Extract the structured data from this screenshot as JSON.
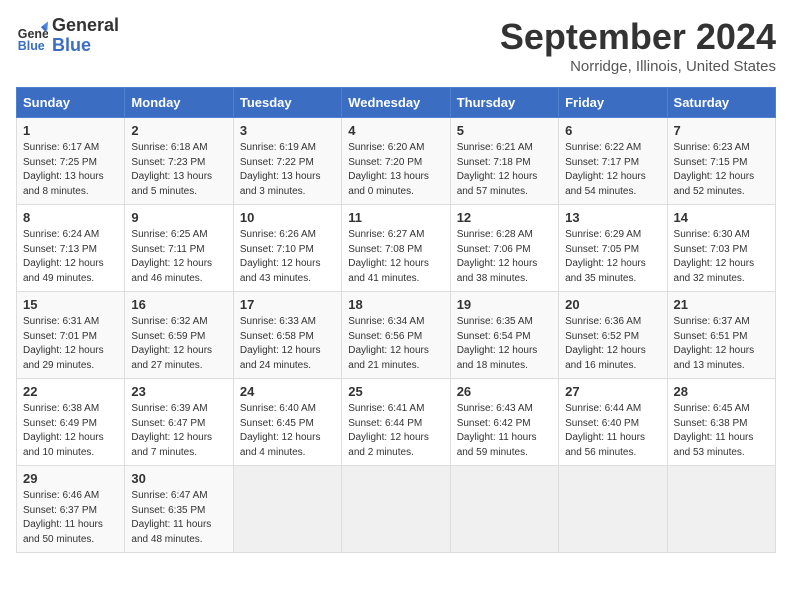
{
  "header": {
    "logo_line1": "General",
    "logo_line2": "Blue",
    "month_title": "September 2024",
    "location": "Norridge, Illinois, United States"
  },
  "days_of_week": [
    "Sunday",
    "Monday",
    "Tuesday",
    "Wednesday",
    "Thursday",
    "Friday",
    "Saturday"
  ],
  "weeks": [
    [
      {
        "day": 1,
        "sunrise": "6:17 AM",
        "sunset": "7:25 PM",
        "daylight": "13 hours and 8 minutes."
      },
      {
        "day": 2,
        "sunrise": "6:18 AM",
        "sunset": "7:23 PM",
        "daylight": "13 hours and 5 minutes."
      },
      {
        "day": 3,
        "sunrise": "6:19 AM",
        "sunset": "7:22 PM",
        "daylight": "13 hours and 3 minutes."
      },
      {
        "day": 4,
        "sunrise": "6:20 AM",
        "sunset": "7:20 PM",
        "daylight": "13 hours and 0 minutes."
      },
      {
        "day": 5,
        "sunrise": "6:21 AM",
        "sunset": "7:18 PM",
        "daylight": "12 hours and 57 minutes."
      },
      {
        "day": 6,
        "sunrise": "6:22 AM",
        "sunset": "7:17 PM",
        "daylight": "12 hours and 54 minutes."
      },
      {
        "day": 7,
        "sunrise": "6:23 AM",
        "sunset": "7:15 PM",
        "daylight": "12 hours and 52 minutes."
      }
    ],
    [
      {
        "day": 8,
        "sunrise": "6:24 AM",
        "sunset": "7:13 PM",
        "daylight": "12 hours and 49 minutes."
      },
      {
        "day": 9,
        "sunrise": "6:25 AM",
        "sunset": "7:11 PM",
        "daylight": "12 hours and 46 minutes."
      },
      {
        "day": 10,
        "sunrise": "6:26 AM",
        "sunset": "7:10 PM",
        "daylight": "12 hours and 43 minutes."
      },
      {
        "day": 11,
        "sunrise": "6:27 AM",
        "sunset": "7:08 PM",
        "daylight": "12 hours and 41 minutes."
      },
      {
        "day": 12,
        "sunrise": "6:28 AM",
        "sunset": "7:06 PM",
        "daylight": "12 hours and 38 minutes."
      },
      {
        "day": 13,
        "sunrise": "6:29 AM",
        "sunset": "7:05 PM",
        "daylight": "12 hours and 35 minutes."
      },
      {
        "day": 14,
        "sunrise": "6:30 AM",
        "sunset": "7:03 PM",
        "daylight": "12 hours and 32 minutes."
      }
    ],
    [
      {
        "day": 15,
        "sunrise": "6:31 AM",
        "sunset": "7:01 PM",
        "daylight": "12 hours and 29 minutes."
      },
      {
        "day": 16,
        "sunrise": "6:32 AM",
        "sunset": "6:59 PM",
        "daylight": "12 hours and 27 minutes."
      },
      {
        "day": 17,
        "sunrise": "6:33 AM",
        "sunset": "6:58 PM",
        "daylight": "12 hours and 24 minutes."
      },
      {
        "day": 18,
        "sunrise": "6:34 AM",
        "sunset": "6:56 PM",
        "daylight": "12 hours and 21 minutes."
      },
      {
        "day": 19,
        "sunrise": "6:35 AM",
        "sunset": "6:54 PM",
        "daylight": "12 hours and 18 minutes."
      },
      {
        "day": 20,
        "sunrise": "6:36 AM",
        "sunset": "6:52 PM",
        "daylight": "12 hours and 16 minutes."
      },
      {
        "day": 21,
        "sunrise": "6:37 AM",
        "sunset": "6:51 PM",
        "daylight": "12 hours and 13 minutes."
      }
    ],
    [
      {
        "day": 22,
        "sunrise": "6:38 AM",
        "sunset": "6:49 PM",
        "daylight": "12 hours and 10 minutes."
      },
      {
        "day": 23,
        "sunrise": "6:39 AM",
        "sunset": "6:47 PM",
        "daylight": "12 hours and 7 minutes."
      },
      {
        "day": 24,
        "sunrise": "6:40 AM",
        "sunset": "6:45 PM",
        "daylight": "12 hours and 4 minutes."
      },
      {
        "day": 25,
        "sunrise": "6:41 AM",
        "sunset": "6:44 PM",
        "daylight": "12 hours and 2 minutes."
      },
      {
        "day": 26,
        "sunrise": "6:43 AM",
        "sunset": "6:42 PM",
        "daylight": "11 hours and 59 minutes."
      },
      {
        "day": 27,
        "sunrise": "6:44 AM",
        "sunset": "6:40 PM",
        "daylight": "11 hours and 56 minutes."
      },
      {
        "day": 28,
        "sunrise": "6:45 AM",
        "sunset": "6:38 PM",
        "daylight": "11 hours and 53 minutes."
      }
    ],
    [
      {
        "day": 29,
        "sunrise": "6:46 AM",
        "sunset": "6:37 PM",
        "daylight": "11 hours and 50 minutes."
      },
      {
        "day": 30,
        "sunrise": "6:47 AM",
        "sunset": "6:35 PM",
        "daylight": "11 hours and 48 minutes."
      },
      null,
      null,
      null,
      null,
      null
    ]
  ]
}
